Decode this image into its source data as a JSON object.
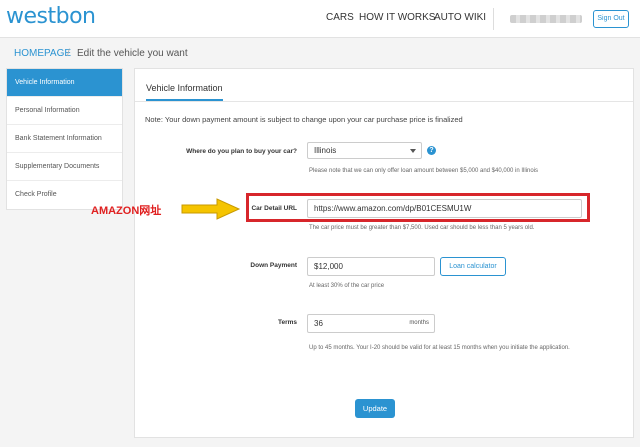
{
  "header": {
    "logo": "westbon",
    "nav": [
      "CARS",
      "HOW IT WORKS",
      "AUTO WIKI"
    ],
    "signout_label": "Sign Out"
  },
  "breadcrumb": {
    "home": "HOMEPAGE",
    "separator": "/",
    "current": "Edit the vehicle you want"
  },
  "sidebar": {
    "items": [
      {
        "label": "Vehicle Information"
      },
      {
        "label": "Personal Information"
      },
      {
        "label": "Bank Statement Information"
      },
      {
        "label": "Supplementary Documents"
      },
      {
        "label": "Check Profile"
      }
    ],
    "active_index": 0
  },
  "form": {
    "tab_label": "Vehicle Information",
    "note": "Note: Your down payment amount is subject to change upon your car purchase price is finalized",
    "where": {
      "label": "Where do you plan to buy your car?",
      "value": "Illinois",
      "help": "?",
      "hint": "Please note that we can only offer loan amount between $5,000 and $40,000 in Illinois"
    },
    "url": {
      "label": "Car Detail URL",
      "value": "https://www.amazon.com/dp/B01CESMU1W",
      "hint": "The car price must be greater than $7,500. Used car should be less than 5 years old."
    },
    "down": {
      "label": "Down Payment",
      "value": "$12,000",
      "button": "Loan calculator",
      "hint": "At least 30% of the car price"
    },
    "terms": {
      "label": "Terms",
      "value": "36",
      "unit": "months",
      "hint": "Up to 45 months. Your I-20 should be valid for at least 15 months when you initiate the application."
    },
    "update_label": "Update"
  },
  "annotation": {
    "text": "AMAZON网址",
    "color": "#e02020",
    "arrow_color": "#f5c400"
  },
  "colors": {
    "accent": "#2b93d1",
    "highlight_box": "#d7262b"
  }
}
